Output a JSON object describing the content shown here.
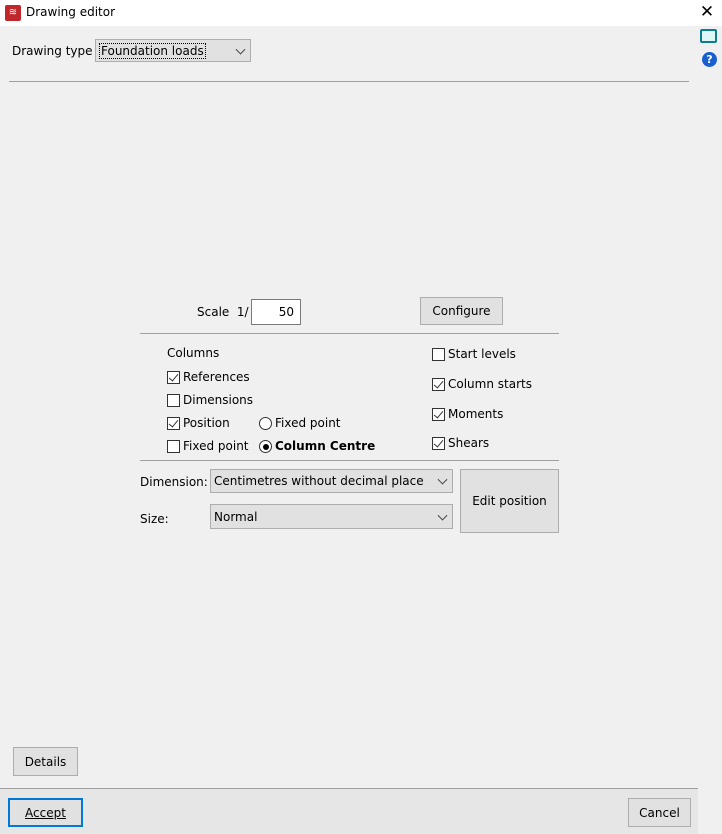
{
  "window": {
    "title": "Drawing editor"
  },
  "header": {
    "drawing_type_label": "Drawing type",
    "drawing_type_value": "Foundation loads"
  },
  "scale": {
    "label": "Scale  1/",
    "value": "50",
    "configure_label": "Configure"
  },
  "columns": {
    "heading": "Columns",
    "references": {
      "label": "References",
      "checked": true
    },
    "dimensions": {
      "label": "Dimensions",
      "checked": false
    },
    "position": {
      "label": "Position",
      "checked": true
    },
    "fixed_point_check": {
      "label": "Fixed point",
      "checked": false
    },
    "radio_fixed_point": {
      "label": "Fixed point",
      "selected": false
    },
    "radio_column_centre": {
      "label": "Column Centre",
      "selected": true
    }
  },
  "right_options": {
    "start_levels": {
      "label": "Start levels",
      "checked": false
    },
    "column_starts": {
      "label": "Column starts",
      "checked": true
    },
    "moments": {
      "label": "Moments",
      "checked": true
    },
    "shears": {
      "label": "Shears",
      "checked": true
    }
  },
  "dimension": {
    "label": "Dimension:",
    "value": "Centimetres without decimal place"
  },
  "size": {
    "label": "Size:",
    "value": "Normal"
  },
  "edit_position_label": "Edit position",
  "details_label": "Details",
  "footer": {
    "accept_label": "Accept",
    "cancel_label": "Cancel"
  }
}
